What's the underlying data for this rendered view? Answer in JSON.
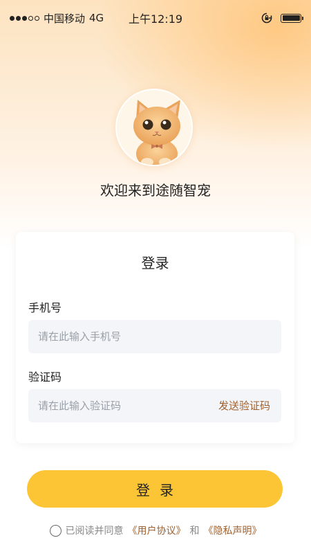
{
  "status_bar": {
    "carrier": "中国移动",
    "network": "4G",
    "time": "上午12:19",
    "signal_level": 3,
    "signal_max": 5,
    "battery_level": 1.0
  },
  "header": {
    "avatar_icon": "cat-mascot-icon",
    "welcome_text": "欢迎来到途随智宠"
  },
  "login_card": {
    "title": "登录",
    "phone_label": "手机号",
    "phone_placeholder": "请在此输入手机号",
    "phone_value": "",
    "code_label": "验证码",
    "code_placeholder": "请在此输入验证码",
    "code_value": "",
    "send_code_label": "发送验证码"
  },
  "login_button": {
    "label": "登录"
  },
  "agreement": {
    "prefix": "已阅读并同意",
    "user_agreement": "《用户协议》",
    "conjunction": "和",
    "privacy_statement": "《隐私声明》",
    "checked": false
  },
  "colors": {
    "accent": "#fcc536",
    "link": "#a0612e",
    "input_bg": "#f3f5f9"
  }
}
